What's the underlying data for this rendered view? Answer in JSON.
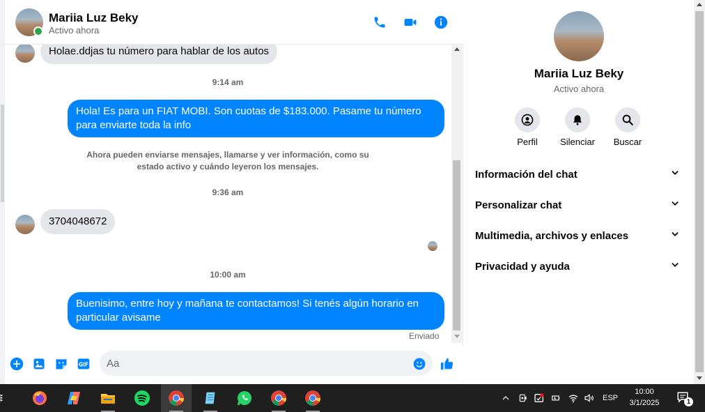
{
  "header": {
    "name": "Mariia Luz Beky",
    "status": "Activo ahora"
  },
  "messages": {
    "first_incoming": "Holae.ddjas tu número para hablar de los autos",
    "time1": "9:14 am",
    "out1": "Hola! Es para un FIAT MOBI. Son cuotas de $183.000. Pasame tu número para enviarte toda la info",
    "system_notice": "Ahora pueden enviarse mensajes, llamarse y ver información, como su estado activo y cuándo leyeron los mensajes.",
    "time2": "9:36 am",
    "in2": "3704048672",
    "time3": "10:00 am",
    "out2": "Buenisimo, entre hoy y mañana te contactamos! Si tenés algún horario en particular avisame",
    "sent_label": "Enviado"
  },
  "composer": {
    "placeholder": "Aa"
  },
  "info": {
    "name": "Mariia Luz Beky",
    "status": "Activo ahora",
    "actions": [
      {
        "label": "Perfil",
        "icon": "profile-icon"
      },
      {
        "label": "Silenciar",
        "icon": "bell-icon"
      },
      {
        "label": "Buscar",
        "icon": "search-icon"
      }
    ],
    "sections": [
      {
        "label": "Información del chat"
      },
      {
        "label": "Personalizar chat"
      },
      {
        "label": "Multimedia, archivos y enlaces"
      },
      {
        "label": "Privacidad y ayuda"
      }
    ]
  },
  "taskbar": {
    "language": "ESP",
    "time": "10:00",
    "date": "3/1/2025",
    "notification_count": "1",
    "apps": [
      "firefox",
      "copilot",
      "file-explorer",
      "spotify",
      "chrome",
      "notepad",
      "whatsapp",
      "chrome",
      "chrome"
    ]
  },
  "colors": {
    "accent": "#0084ff",
    "incoming_bubble": "#e4e6eb",
    "online": "#31a24c",
    "taskbar": "#1f1f1f"
  }
}
